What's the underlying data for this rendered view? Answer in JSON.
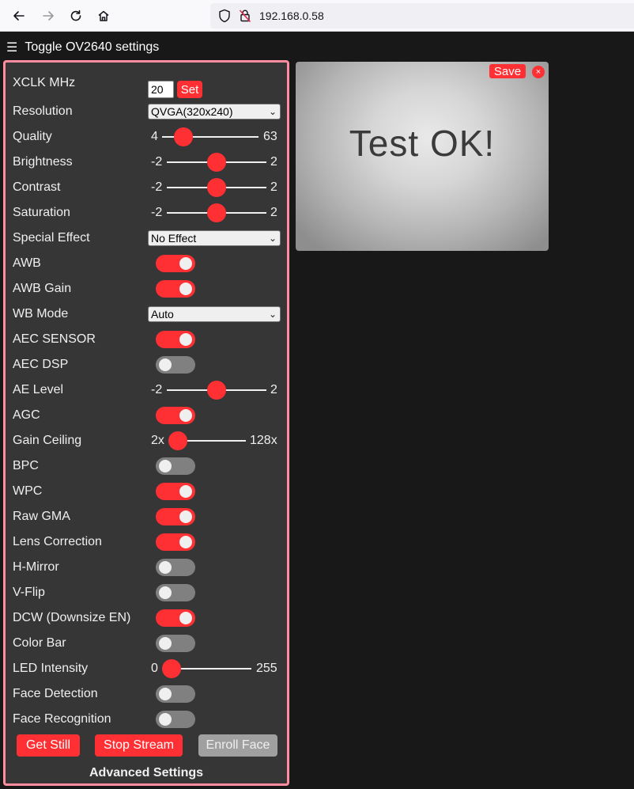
{
  "browser": {
    "url": "192.168.0.58"
  },
  "header": {
    "menu_icon": "☰",
    "title": "Toggle OV2640 settings"
  },
  "settings": {
    "xclk": {
      "label": "XCLK MHz",
      "value": "20",
      "set_label": "Set"
    },
    "resolution": {
      "label": "Resolution",
      "value": "QVGA(320x240)"
    },
    "quality": {
      "label": "Quality",
      "min": "4",
      "max": "63",
      "value": 10
    },
    "brightness": {
      "label": "Brightness",
      "min": "-2",
      "max": "2",
      "value": 0
    },
    "contrast": {
      "label": "Contrast",
      "min": "-2",
      "max": "2",
      "value": 0
    },
    "saturation": {
      "label": "Saturation",
      "min": "-2",
      "max": "2",
      "value": 0
    },
    "special_effect": {
      "label": "Special Effect",
      "value": "No Effect"
    },
    "awb": {
      "label": "AWB",
      "on": true
    },
    "awb_gain": {
      "label": "AWB Gain",
      "on": true
    },
    "wb_mode": {
      "label": "WB Mode",
      "value": "Auto"
    },
    "aec_sensor": {
      "label": "AEC SENSOR",
      "on": true
    },
    "aec_dsp": {
      "label": "AEC DSP",
      "on": false
    },
    "ae_level": {
      "label": "AE Level",
      "min": "-2",
      "max": "2",
      "value": 0
    },
    "agc": {
      "label": "AGC",
      "on": true
    },
    "gain_ceiling": {
      "label": "Gain Ceiling",
      "min": "2x",
      "max": "128x",
      "value": 0
    },
    "bpc": {
      "label": "BPC",
      "on": false
    },
    "wpc": {
      "label": "WPC",
      "on": true
    },
    "raw_gma": {
      "label": "Raw GMA",
      "on": true
    },
    "lens_correction": {
      "label": "Lens Correction",
      "on": true
    },
    "h_mirror": {
      "label": "H-Mirror",
      "on": false
    },
    "v_flip": {
      "label": "V-Flip",
      "on": false
    },
    "dcw": {
      "label": "DCW (Downsize EN)",
      "on": true
    },
    "color_bar": {
      "label": "Color Bar",
      "on": false
    },
    "led_intensity": {
      "label": "LED Intensity",
      "min": "0",
      "max": "255",
      "value": 0
    },
    "face_detection": {
      "label": "Face Detection",
      "on": false
    },
    "face_recognition": {
      "label": "Face Recognition",
      "on": false
    }
  },
  "actions": {
    "get_still": "Get Still",
    "stop_stream": "Stop Stream",
    "enroll_face": "Enroll Face",
    "advanced": "Advanced Settings"
  },
  "stream": {
    "save_label": "Save",
    "close_label": "×",
    "image_text": "Test OK!"
  },
  "colors": {
    "accent": "#ff3034",
    "panel_border": "#ff8da0",
    "panel_bg": "#363636",
    "page_bg": "#181818"
  }
}
